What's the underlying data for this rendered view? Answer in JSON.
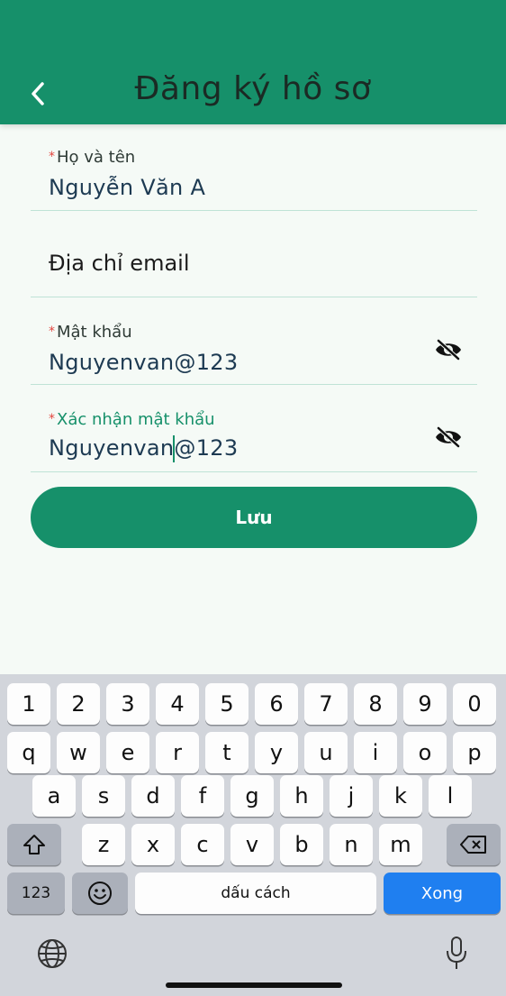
{
  "header": {
    "title": "Đăng ký hồ sơ",
    "back_icon": "chevron-left-icon",
    "color": "#16906a"
  },
  "form": {
    "full_name": {
      "required_mark": "*",
      "label": "Họ và tên",
      "value": "Nguyễn Văn A"
    },
    "email": {
      "placeholder": "Địa chỉ email"
    },
    "password": {
      "required_mark": "*",
      "label": "Mật khẩu",
      "value": "Nguyenvan@123",
      "toggle_icon": "eye-off-icon"
    },
    "confirm_password": {
      "required_mark": "*",
      "label": "Xác nhận mật khẩu",
      "value_before_caret": "Nguyenvan",
      "value_after_caret": "@123",
      "toggle_icon": "eye-off-icon",
      "label_color": "#16906a"
    },
    "save_label": "Lưu"
  },
  "keyboard": {
    "row_numbers": [
      "1",
      "2",
      "3",
      "4",
      "5",
      "6",
      "7",
      "8",
      "9",
      "0"
    ],
    "row_1": [
      "q",
      "w",
      "e",
      "r",
      "t",
      "y",
      "u",
      "i",
      "o",
      "p"
    ],
    "row_2": [
      "a",
      "s",
      "d",
      "f",
      "g",
      "h",
      "j",
      "k",
      "l"
    ],
    "row_3": [
      "z",
      "x",
      "c",
      "v",
      "b",
      "n",
      "m"
    ],
    "numbers_label": "123",
    "space_label": "dấu cách",
    "done_label": "Xong",
    "icons": [
      "shift-icon",
      "backspace-icon",
      "emoji-icon",
      "globe-icon",
      "microphone-icon"
    ]
  }
}
